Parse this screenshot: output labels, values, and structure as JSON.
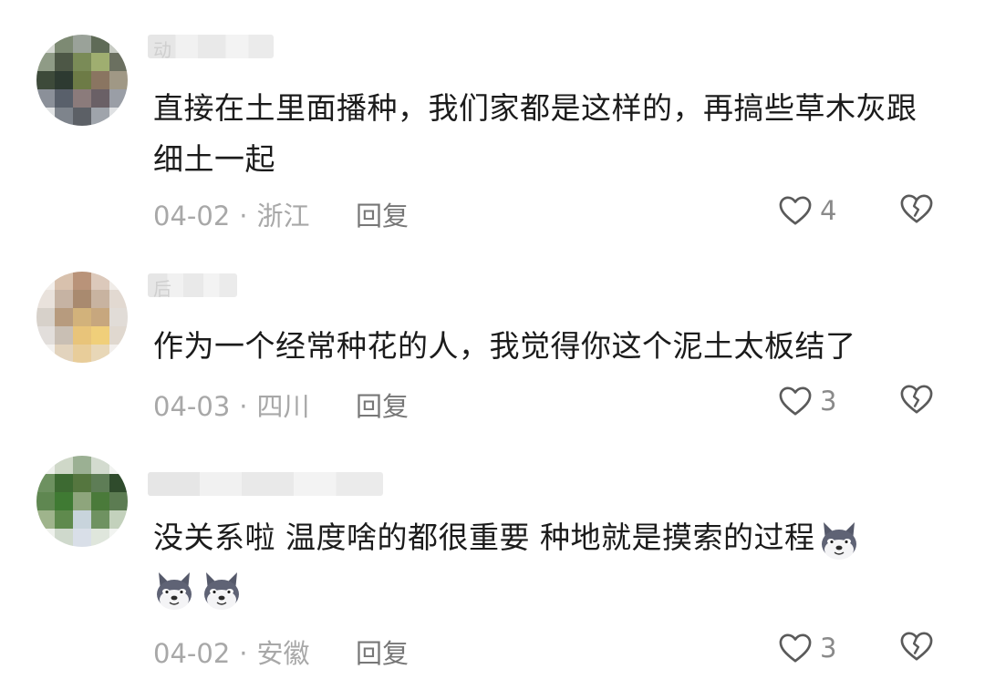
{
  "comments": [
    {
      "name_hint": "动",
      "text": "直接在土里面播种，我们家都是这样的，再搞些草木灰跟细土一起",
      "date": "04-02",
      "location": "浙江",
      "reply_label": "回复",
      "likes": "4"
    },
    {
      "name_hint": "后",
      "text": "作为一个经常种花的人，我觉得你这个泥土太板结了",
      "date": "04-03",
      "location": "四川",
      "reply_label": "回复",
      "likes": "3"
    },
    {
      "name_hint": "",
      "text": "没关系啦 温度啥的都很重要  种地就是摸索的过程",
      "date": "04-02",
      "location": "安徽",
      "reply_label": "回复",
      "likes": "3"
    }
  ],
  "separator": "·",
  "icons": {
    "like": "heart-outline-icon",
    "dislike": "broken-heart-icon",
    "emoji": "husky-dog-emoji-icon"
  },
  "colors": {
    "text": "#1b1b1b",
    "meta": "#a8a8a8",
    "icon": "#5a5a5a"
  }
}
